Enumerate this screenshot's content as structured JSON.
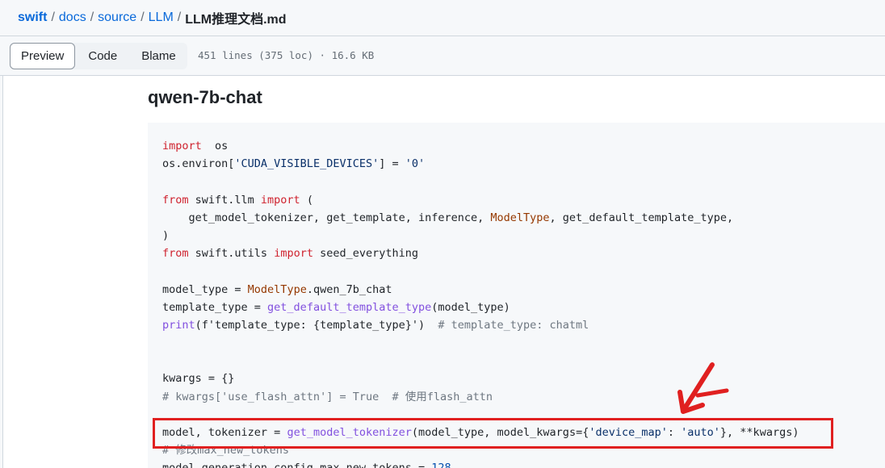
{
  "breadcrumb": {
    "root": "swift",
    "parts": [
      "docs",
      "source",
      "LLM"
    ],
    "file": "LLM推理文档.md",
    "separator": "/"
  },
  "toolbar": {
    "tabs": [
      "Preview",
      "Code",
      "Blame"
    ],
    "active_tab": "Preview",
    "file_meta": "451 lines (375 loc) · 16.6 KB"
  },
  "heading": "qwen-7b-chat",
  "code": {
    "lines": [
      [
        [
          "kw",
          "import"
        ],
        [
          "",
          "  os"
        ]
      ],
      [
        [
          "",
          "os.environ["
        ],
        [
          "str",
          "'CUDA_VISIBLE_DEVICES'"
        ],
        [
          "",
          "] = "
        ],
        [
          "str",
          "'0'"
        ]
      ],
      [],
      [
        [
          "kw",
          "from"
        ],
        [
          "",
          " swift.llm "
        ],
        [
          "kw",
          "import"
        ],
        [
          "",
          " ("
        ]
      ],
      [
        [
          "",
          "    get_model_tokenizer, get_template, inference, "
        ],
        [
          "cls",
          "ModelType"
        ],
        [
          "",
          ", get_default_template_type,"
        ]
      ],
      [
        [
          "",
          ")"
        ]
      ],
      [
        [
          "kw",
          "from"
        ],
        [
          "",
          " swift.utils "
        ],
        [
          "kw",
          "import"
        ],
        [
          "",
          " seed_everything"
        ]
      ],
      [],
      [
        [
          "",
          "model_type = "
        ],
        [
          "cls",
          "ModelType"
        ],
        [
          "",
          ".qwen_7b_chat"
        ]
      ],
      [
        [
          "",
          "template_type = "
        ],
        [
          "fn",
          "get_default_template_type"
        ],
        [
          "",
          "(model_type)"
        ]
      ],
      [
        [
          "fn",
          "print"
        ],
        [
          "",
          "(f'template_type: {template_type}')  "
        ],
        [
          "cm",
          "# template_type: chatml"
        ]
      ],
      [],
      [],
      [
        [
          "",
          "kwargs = {}"
        ]
      ],
      [
        [
          "cm",
          "# kwargs['use_flash_attn'] = True  # 使用flash_attn"
        ]
      ],
      [],
      [
        [
          "",
          "model, tokenizer = "
        ],
        [
          "fn",
          "get_model_tokenizer"
        ],
        [
          "",
          "(model_type, model_kwargs={"
        ],
        [
          "str",
          "'device_map'"
        ],
        [
          "",
          ": "
        ],
        [
          "str",
          "'auto'"
        ],
        [
          "",
          "}, **kwargs)"
        ]
      ],
      [
        [
          "cm",
          "# 修改max_new_tokens"
        ]
      ],
      [
        [
          "",
          "model.generation_config.max_new_tokens = "
        ],
        [
          "num",
          "128"
        ]
      ]
    ]
  },
  "colors": {
    "link": "#0969da",
    "highlight_box": "#e02020",
    "code_bg": "#f6f8fa"
  }
}
